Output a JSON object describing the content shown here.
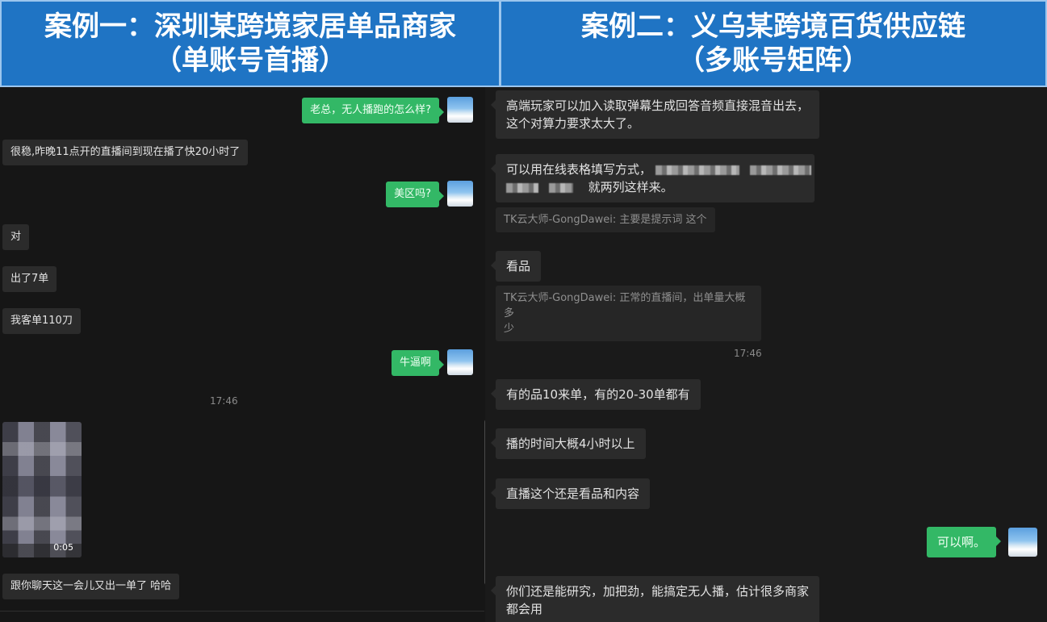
{
  "headers": {
    "left": {
      "line1": "案例一：深圳某跨境家居单品商家",
      "line2": "（单账号首播）"
    },
    "right": {
      "line1": "案例二：义乌某跨境百货供应链",
      "line2": "（多账号矩阵）"
    }
  },
  "left_chat": {
    "messages": [
      {
        "from": "me",
        "text": "老总，无人播跑的怎么样?"
      },
      {
        "from": "other",
        "text": "很稳,昨晚11点开的直播间到现在播了快20小时了"
      },
      {
        "from": "me",
        "text": "美区吗?"
      },
      {
        "from": "other",
        "text": "对"
      },
      {
        "from": "other",
        "text": "出了7单"
      },
      {
        "from": "other",
        "text": "我客单110刀"
      },
      {
        "from": "me",
        "text": "牛逼啊"
      },
      {
        "from": "time",
        "text": "17:46"
      },
      {
        "from": "other",
        "type": "video",
        "duration": "0:05"
      },
      {
        "from": "other",
        "text": "跟你聊天这一会儿又出一单了 哈哈"
      }
    ]
  },
  "right_chat": {
    "messages": [
      {
        "from": "other",
        "text_l1": "高端玩家可以加入读取弹幕生成回答音频直接混音出去，",
        "text_l2": "这个对算力要求太大了。"
      },
      {
        "from": "other",
        "text_l1": "可以用在线表格填写方式，",
        "text_l2": "就两列这样来。"
      },
      {
        "from": "quote",
        "text": "TK云大师-GongDawei: 主要是提示词 这个"
      },
      {
        "from": "other",
        "text": "看品"
      },
      {
        "from": "quote",
        "text_l1": "TK云大师-GongDawei: 正常的直播间，出单量大概多",
        "text_l2": "少"
      },
      {
        "from": "time",
        "text": "17:46"
      },
      {
        "from": "other",
        "text": "有的品10来单，有的20-30单都有"
      },
      {
        "from": "other",
        "text": "播的时间大概4小时以上"
      },
      {
        "from": "other",
        "text": "直播这个还是看品和内容"
      },
      {
        "from": "me",
        "text": "可以啊。"
      },
      {
        "from": "other",
        "text_l1": "你们还是能研究，加把劲，能搞定无人播，估计很多商家",
        "text_l2": "都会用"
      }
    ]
  },
  "colors": {
    "header_bg": "#1f74c4",
    "my_bubble": "#33b866",
    "other_bubble": "#2b2b2b",
    "chat_bg": "#161616"
  }
}
